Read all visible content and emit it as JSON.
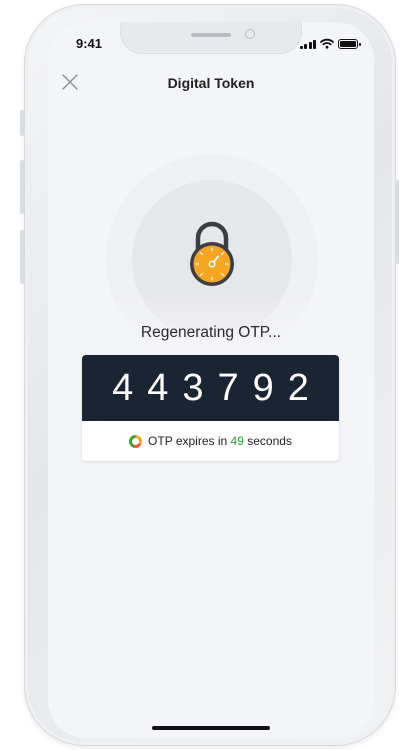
{
  "status_bar": {
    "time": "9:41"
  },
  "header": {
    "title": "Digital Token"
  },
  "token": {
    "status_message": "Regenerating OTP...",
    "otp_code": "443792",
    "expiry_prefix": "OTP expires in",
    "expiry_seconds": "49",
    "expiry_suffix": "seconds"
  },
  "icons": [
    "close-icon",
    "padlock-icon",
    "countdown-ring-icon",
    "signal-icon",
    "wifi-icon",
    "battery-icon"
  ],
  "colors": {
    "otp_background": "#1a2533",
    "lock_orange": "#f5a623",
    "seconds_green": "#2d9b3a"
  }
}
